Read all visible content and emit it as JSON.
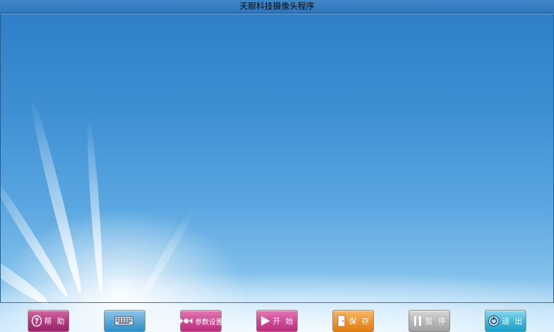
{
  "window": {
    "title": "天眼科技摄像头程序"
  },
  "toolbar": {
    "buttons": [
      {
        "id": "help",
        "label": "帮 助",
        "icon": "question-icon"
      },
      {
        "id": "keyboard",
        "label": "",
        "icon": "keyboard-icon"
      },
      {
        "id": "params",
        "label": "参数设置",
        "icon": "gears-icon"
      },
      {
        "id": "start",
        "label": "开 始",
        "icon": "play-icon"
      },
      {
        "id": "save",
        "label": "保 存",
        "icon": "door-icon"
      },
      {
        "id": "pause",
        "label": "暂 停",
        "icon": "pause-icon"
      },
      {
        "id": "exit",
        "label": "退 出",
        "icon": "power-icon"
      }
    ]
  },
  "colors": {
    "titlebar": "#2f78bd",
    "sky": "#3d8fd2",
    "help": "#b23c80",
    "keyboard": "#5fa9d8",
    "params": "#cf4b95",
    "start": "#cf4b95",
    "save": "#ee9730",
    "pause": "#b8b8b8",
    "exit": "#45b9d9"
  }
}
